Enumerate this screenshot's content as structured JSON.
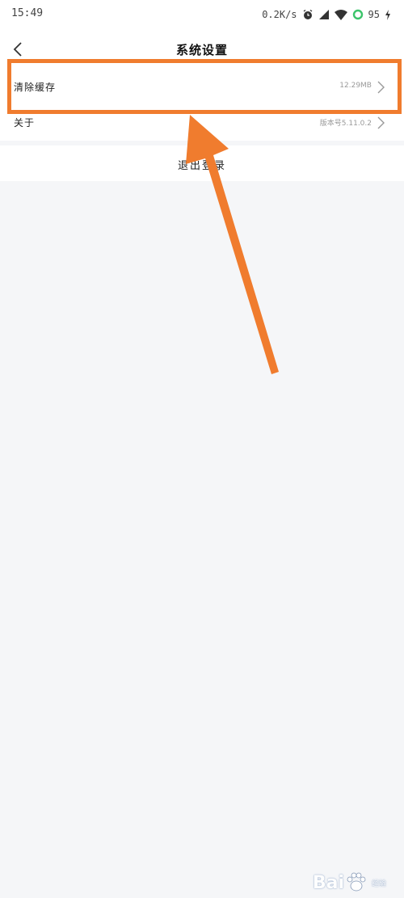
{
  "status_bar": {
    "time": "15:49",
    "network_speed": "0.2K/s",
    "battery": "95",
    "icons": [
      "alarm-icon",
      "no-sim-icon",
      "wifi-icon",
      "battery-ring-icon",
      "charging-icon"
    ]
  },
  "header": {
    "title": "系统设置",
    "back_icon": "chevron-left-icon"
  },
  "settings": {
    "items": [
      {
        "label": "清除缓存",
        "value": "12.29MB"
      },
      {
        "label": "关于",
        "value": "版本号5.11.0.2"
      }
    ]
  },
  "logout": {
    "label": "退出登录"
  },
  "annotation": {
    "color": "#f07c2e"
  },
  "watermark": {
    "text": "Bai",
    "sub": "经验"
  },
  "colors": {
    "background": "#f5f6f8",
    "surface": "#ffffff",
    "accent": "#f07c2e"
  }
}
